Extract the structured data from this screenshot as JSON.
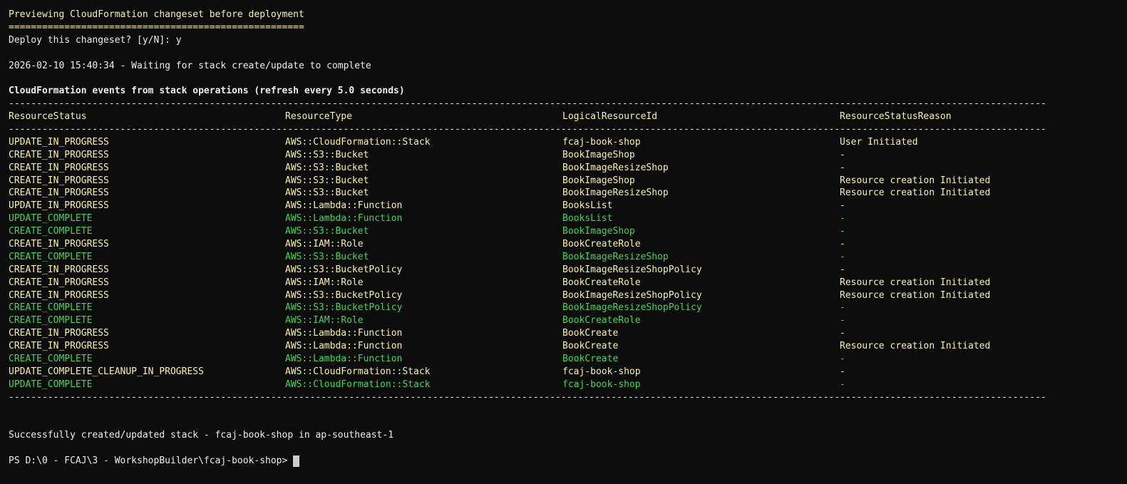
{
  "header": {
    "preview_title": "Previewing CloudFormation changeset before deployment",
    "underline": "=====================================================",
    "deploy_prompt": "Deploy this changeset? [y/N]: y",
    "waiting": "2026-02-10 15:40:34 - Waiting for stack create/update to complete",
    "events_title": "CloudFormation events from stack operations (refresh every 5.0 seconds)"
  },
  "table": {
    "rule": "------------------------------------------------------------------------------------------------------------------------------------------------------------------------------------------",
    "headers": [
      "ResourceStatus",
      "ResourceType",
      "LogicalResourceId",
      "ResourceStatusReason"
    ],
    "rows": [
      {
        "status": "UPDATE_IN_PROGRESS",
        "type": "AWS::CloudFormation::Stack",
        "id": "fcaj-book-shop",
        "reason": "User Initiated",
        "color": "yellow"
      },
      {
        "status": "CREATE_IN_PROGRESS",
        "type": "AWS::S3::Bucket",
        "id": "BookImageShop",
        "reason": "-",
        "color": "yellow"
      },
      {
        "status": "CREATE_IN_PROGRESS",
        "type": "AWS::S3::Bucket",
        "id": "BookImageResizeShop",
        "reason": "-",
        "color": "yellow"
      },
      {
        "status": "CREATE_IN_PROGRESS",
        "type": "AWS::S3::Bucket",
        "id": "BookImageShop",
        "reason": "Resource creation Initiated",
        "color": "yellow"
      },
      {
        "status": "CREATE_IN_PROGRESS",
        "type": "AWS::S3::Bucket",
        "id": "BookImageResizeShop",
        "reason": "Resource creation Initiated",
        "color": "yellow"
      },
      {
        "status": "UPDATE_IN_PROGRESS",
        "type": "AWS::Lambda::Function",
        "id": "BooksList",
        "reason": "-",
        "color": "yellow"
      },
      {
        "status": "UPDATE_COMPLETE",
        "type": "AWS::Lambda::Function",
        "id": "BooksList",
        "reason": "-",
        "color": "green"
      },
      {
        "status": "CREATE_COMPLETE",
        "type": "AWS::S3::Bucket",
        "id": "BookImageShop",
        "reason": "-",
        "color": "green"
      },
      {
        "status": "CREATE_IN_PROGRESS",
        "type": "AWS::IAM::Role",
        "id": "BookCreateRole",
        "reason": "-",
        "color": "yellow"
      },
      {
        "status": "CREATE_COMPLETE",
        "type": "AWS::S3::Bucket",
        "id": "BookImageResizeShop",
        "reason": "-",
        "color": "green"
      },
      {
        "status": "CREATE_IN_PROGRESS",
        "type": "AWS::S3::BucketPolicy",
        "id": "BookImageResizeShopPolicy",
        "reason": "-",
        "color": "yellow"
      },
      {
        "status": "CREATE_IN_PROGRESS",
        "type": "AWS::IAM::Role",
        "id": "BookCreateRole",
        "reason": "Resource creation Initiated",
        "color": "yellow"
      },
      {
        "status": "CREATE_IN_PROGRESS",
        "type": "AWS::S3::BucketPolicy",
        "id": "BookImageResizeShopPolicy",
        "reason": "Resource creation Initiated",
        "color": "yellow"
      },
      {
        "status": "CREATE_COMPLETE",
        "type": "AWS::S3::BucketPolicy",
        "id": "BookImageResizeShopPolicy",
        "reason": "-",
        "color": "green"
      },
      {
        "status": "CREATE_COMPLETE",
        "type": "AWS::IAM::Role",
        "id": "BookCreateRole",
        "reason": "-",
        "color": "green"
      },
      {
        "status": "CREATE_IN_PROGRESS",
        "type": "AWS::Lambda::Function",
        "id": "BookCreate",
        "reason": "-",
        "color": "yellow"
      },
      {
        "status": "CREATE_IN_PROGRESS",
        "type": "AWS::Lambda::Function",
        "id": "BookCreate",
        "reason": "Resource creation Initiated",
        "color": "yellow"
      },
      {
        "status": "CREATE_COMPLETE",
        "type": "AWS::Lambda::Function",
        "id": "BookCreate",
        "reason": "-",
        "color": "green"
      },
      {
        "status": "UPDATE_COMPLETE_CLEANUP_IN_PROGRESS",
        "type": "AWS::CloudFormation::Stack",
        "id": "fcaj-book-shop",
        "reason": "-",
        "color": "yellow"
      },
      {
        "status": "UPDATE_COMPLETE",
        "type": "AWS::CloudFormation::Stack",
        "id": "fcaj-book-shop",
        "reason": "-",
        "color": "green"
      }
    ]
  },
  "footer": {
    "success": "Successfully created/updated stack - fcaj-book-shop in ap-southeast-1",
    "prompt": "PS D:\\0 - FCAJ\\3 - WorkshopBuilder\\fcaj-book-shop> "
  },
  "colors": {
    "background": "#0c0c0c",
    "yellow": "#f9f1a5",
    "green": "#3fd65a",
    "text": "#eeeeee"
  }
}
